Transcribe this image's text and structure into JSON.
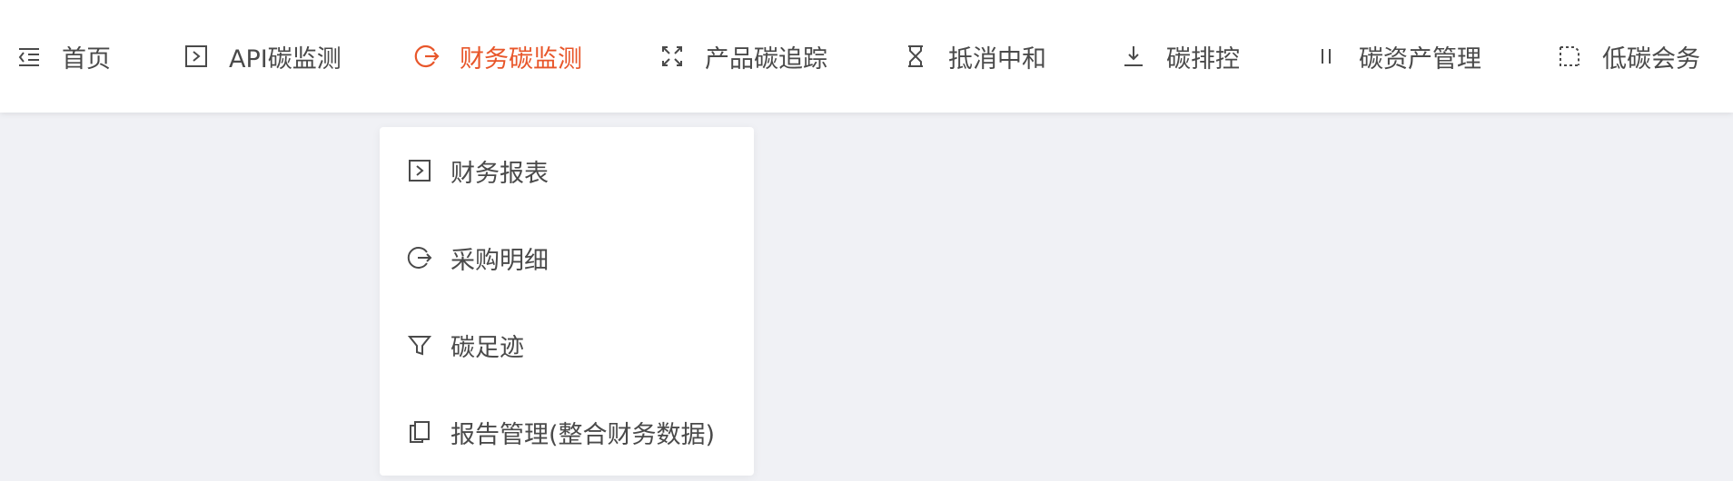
{
  "colors": {
    "accent": "#e8562a",
    "text": "#4a4a4a",
    "background": "#f0f1f5",
    "panel": "#ffffff"
  },
  "nav": {
    "items": [
      {
        "label": "首页",
        "icon": "menu-indent-icon"
      },
      {
        "label": "API碳监测",
        "icon": "play-square-icon"
      },
      {
        "label": "财务碳监测",
        "icon": "logout-circle-icon",
        "active": true
      },
      {
        "label": "产品碳追踪",
        "icon": "fullscreen-icon"
      },
      {
        "label": "抵消中和",
        "icon": "hourglass-icon"
      },
      {
        "label": "碳排控",
        "icon": "download-icon"
      },
      {
        "label": "碳资产管理",
        "icon": "pause-icon"
      },
      {
        "label": "低碳会务",
        "icon": "dashed-square-icon"
      }
    ]
  },
  "dropdown": {
    "items": [
      {
        "label": "财务报表",
        "icon": "play-square-icon"
      },
      {
        "label": "采购明细",
        "icon": "logout-circle-icon"
      },
      {
        "label": "碳足迹",
        "icon": "filter-icon"
      },
      {
        "label": "报告管理(整合财务数据)",
        "icon": "copy-icon"
      }
    ]
  }
}
